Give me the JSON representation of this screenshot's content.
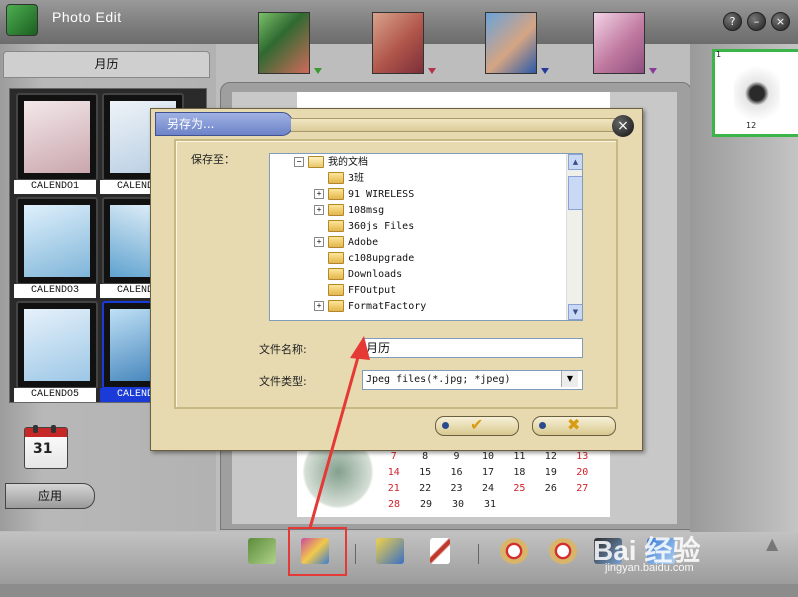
{
  "app": {
    "title": "Photo Edit"
  },
  "window_controls": {
    "help": "?",
    "minimize": "–",
    "close": "×"
  },
  "sidebar": {
    "header": "月历",
    "templates": [
      {
        "label": "CALENDO1",
        "selected": false
      },
      {
        "label": "CALENDO2",
        "selected": false
      },
      {
        "label": "CALENDO3",
        "selected": false
      },
      {
        "label": "CALENDO4",
        "selected": false
      },
      {
        "label": "CALENDO5",
        "selected": false
      },
      {
        "label": "CALENDO6",
        "selected": true
      }
    ],
    "calendar_icon_day": "31",
    "apply_label": "应用"
  },
  "pages": {
    "index": "1",
    "count": "12"
  },
  "calendar_preview": {
    "rows": [
      [
        "7",
        "8",
        "9",
        "10",
        "11",
        "12",
        "13"
      ],
      [
        "14",
        "15",
        "16",
        "17",
        "18",
        "19",
        "20"
      ],
      [
        "21",
        "22",
        "23",
        "24",
        "25",
        "26",
        "27"
      ],
      [
        "28",
        "29",
        "30",
        "31",
        "",
        "",
        ""
      ]
    ]
  },
  "save_dialog": {
    "title": "另存为...",
    "save_to_label": "保存至：",
    "tree": [
      {
        "label": "我的文档",
        "level": 0,
        "expander": "−"
      },
      {
        "label": "3班",
        "level": 1,
        "expander": ""
      },
      {
        "label": "91 WIRELESS",
        "level": 1,
        "expander": "+"
      },
      {
        "label": "108msg",
        "level": 1,
        "expander": "+"
      },
      {
        "label": "360js Files",
        "level": 1,
        "expander": ""
      },
      {
        "label": "Adobe",
        "level": 1,
        "expander": "+"
      },
      {
        "label": "c108upgrade",
        "level": 1,
        "expander": ""
      },
      {
        "label": "Downloads",
        "level": 1,
        "expander": ""
      },
      {
        "label": "FFOutput",
        "level": 1,
        "expander": ""
      },
      {
        "label": "FormatFactory",
        "level": 1,
        "expander": "+"
      }
    ],
    "filename_label": "文件名称:",
    "filename_value": "月历",
    "filetype_label": "文件类型:",
    "filetype_value": "Jpeg files(*.jpg; *jpeg)",
    "ok_glyph": "✔",
    "cancel_glyph": "✖",
    "close_glyph": "×"
  },
  "watermark": {
    "text": "Bai 经验",
    "url": "jingyan.baidu.com"
  },
  "colors": {
    "highlight": "#e53935",
    "selected_label": "#1a3bd8",
    "accent_green": "#3bb54a"
  }
}
